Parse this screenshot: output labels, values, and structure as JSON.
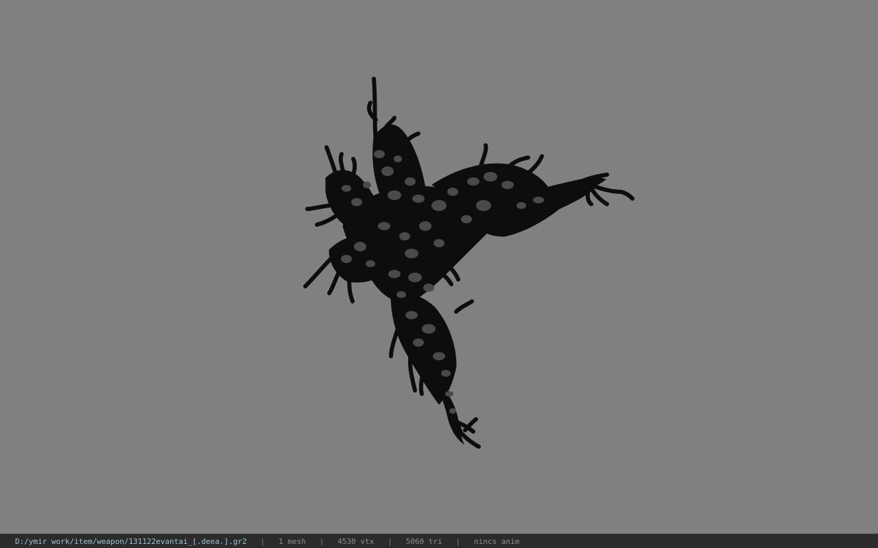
{
  "viewer": {
    "background_color": "#808080",
    "model_color": "#0d0d0d",
    "spot_color": "#4a4a4a"
  },
  "status": {
    "path": "D:/ymir work/item/weapon/131122evantai_[.deea.].gr2",
    "separator": "|",
    "mesh": "1 mesh",
    "vtx": "4530 vtx",
    "tri": "5060 tri",
    "anim": "nincs anim"
  }
}
